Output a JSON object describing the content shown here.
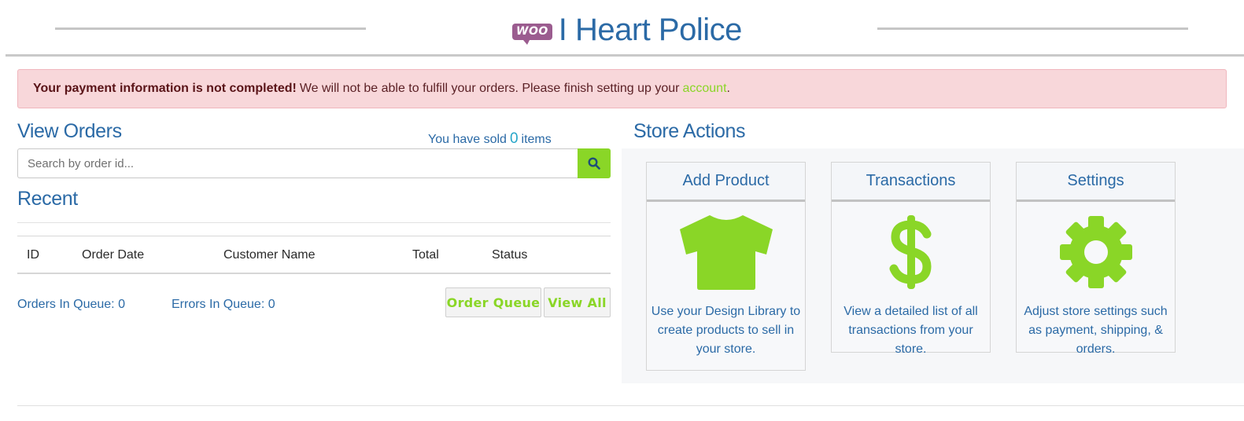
{
  "header": {
    "logo_text": "WOO",
    "store_name": "I Heart Police"
  },
  "alert": {
    "strong": "Your payment information is not completed!",
    "message": "We will not be able to fulfill your orders. Please finish setting up your",
    "link": "account",
    "end": "."
  },
  "orders": {
    "title": "View Orders",
    "sold_prefix": "You have sold",
    "sold_count": "0",
    "sold_suffix": "items",
    "search_placeholder": "Search by order id...",
    "recent_title": "Recent",
    "columns": [
      "ID",
      "Order Date",
      "Customer Name",
      "Total",
      "Status"
    ],
    "rows": [],
    "in_queue_label": "Orders In Queue:",
    "in_queue_value": "0",
    "errors_label": "Errors In Queue:",
    "errors_value": "0",
    "btn_queue": "Order Queue",
    "btn_view_all": "View All"
  },
  "actions": {
    "title": "Store Actions",
    "cards": [
      {
        "title": "Add Product",
        "icon": "tshirt-icon",
        "desc": "Use your Design Library to create products to sell in your store."
      },
      {
        "title": "Transactions",
        "icon": "dollar-icon",
        "desc": "View a detailed list of all transactions from your store."
      },
      {
        "title": "Settings",
        "icon": "gear-icon",
        "desc": "Adjust store settings such as payment, shipping, & orders."
      }
    ]
  },
  "colors": {
    "primary": "#2b6aa6",
    "accent": "#8ad627",
    "alert_bg": "#f8d7da",
    "woo": "#9b5c8f"
  }
}
